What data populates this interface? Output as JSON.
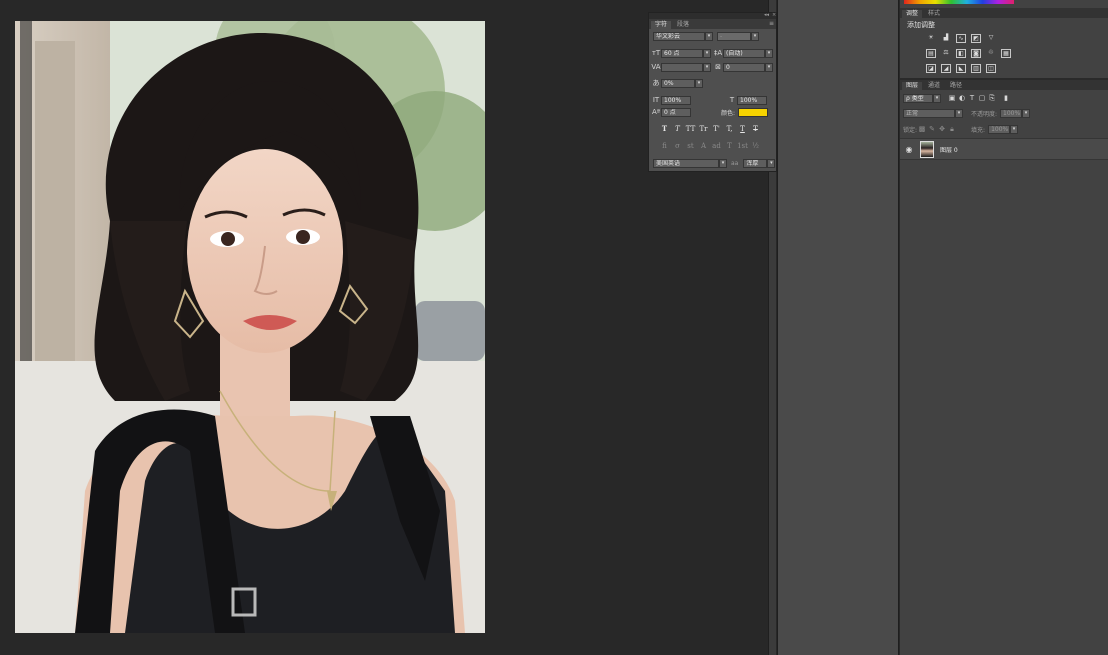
{
  "canvas": {
    "image_desc_name": "portrait-photo"
  },
  "character_panel": {
    "tabs": [
      "字符",
      "段落"
    ],
    "font_family": "华文彩云",
    "font_style": "-",
    "font_size": "60 点",
    "leading": "(自动)",
    "kerning_label": "VA",
    "kerning": "",
    "tracking": "0",
    "tsume": "0%",
    "vertical_scale": "100%",
    "horizontal_scale": "100%",
    "baseline_shift": "0 点",
    "color_label": "颜色:",
    "text_color": "#f6d300",
    "style_buttons": [
      "T",
      "T",
      "TT",
      "Tr",
      "T'",
      "T,",
      "T",
      "T"
    ],
    "opentype_buttons": [
      "fi",
      "σ",
      "st",
      "A",
      "ad",
      "T",
      "1st",
      "½"
    ],
    "language": "美国英语",
    "aa_label": "aa",
    "antialias": "浑厚"
  },
  "adjustments_panel": {
    "tabs": [
      "调整",
      "样式"
    ],
    "title": "添加调整"
  },
  "layers_panel": {
    "tabs": [
      "图层",
      "通道",
      "路径"
    ],
    "filter_kind": "ρ 类型",
    "blend_mode": "正常",
    "opacity_label": "不透明度:",
    "opacity": "100%",
    "lock_label": "锁定:",
    "fill_label": "填充:",
    "fill": "100%",
    "layers": [
      {
        "name": "图层 0",
        "visible": true
      }
    ]
  },
  "colors": {
    "text_swatch": "#f6d300",
    "workspace": "#282828"
  }
}
